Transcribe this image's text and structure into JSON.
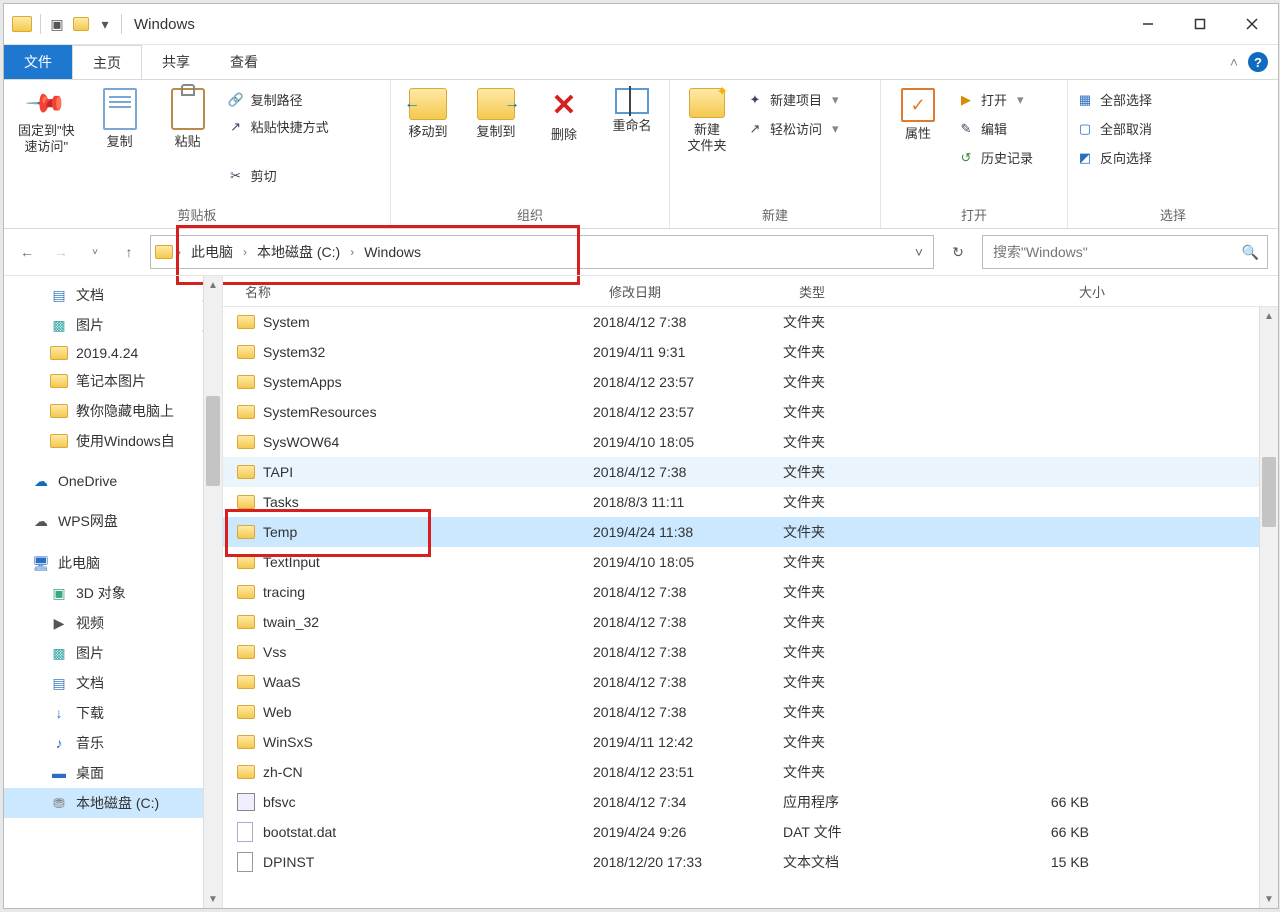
{
  "window": {
    "title": "Windows"
  },
  "tabs": {
    "file": "文件",
    "home": "主页",
    "share": "共享",
    "view": "查看"
  },
  "ribbon": {
    "clipboard": {
      "pin": "固定到\"快\n速访问\"",
      "copy": "复制",
      "paste": "粘贴",
      "copy_path": "复制路径",
      "paste_shortcut": "粘贴快捷方式",
      "cut": "剪切",
      "group": "剪贴板"
    },
    "organize": {
      "move_to": "移动到",
      "copy_to": "复制到",
      "delete": "删除",
      "rename": "重命名",
      "group": "组织"
    },
    "new": {
      "new_folder": "新建\n文件夹",
      "new_item": "新建项目",
      "easy_access": "轻松访问",
      "group": "新建"
    },
    "open": {
      "properties": "属性",
      "open": "打开",
      "edit": "编辑",
      "history": "历史记录",
      "group": "打开"
    },
    "select": {
      "select_all": "全部选择",
      "select_none": "全部取消",
      "invert": "反向选择",
      "group": "选择"
    }
  },
  "breadcrumb": {
    "pc": "此电脑",
    "drive": "本地磁盘 (C:)",
    "folder": "Windows"
  },
  "search": {
    "placeholder": "搜索\"Windows\""
  },
  "sidebar": {
    "documents": "文档",
    "pictures": "图片",
    "date_folder": "2019.4.24",
    "notebook_pics": "笔记本图片",
    "teach_hide_pc": "教你隐藏电脑上",
    "use_windows": "使用Windows自",
    "onedrive": "OneDrive",
    "wps": "WPS网盘",
    "this_pc": "此电脑",
    "objects3d": "3D 对象",
    "videos": "视频",
    "pictures2": "图片",
    "documents2": "文档",
    "downloads": "下载",
    "music": "音乐",
    "desktop": "桌面",
    "local_disk_c": "本地磁盘 (C:)"
  },
  "columns": {
    "name": "名称",
    "date": "修改日期",
    "type": "类型",
    "size": "大小"
  },
  "files": [
    {
      "icon": "folder",
      "name": "System",
      "date": "2018/4/12 7:38",
      "type": "文件夹",
      "size": ""
    },
    {
      "icon": "folder",
      "name": "System32",
      "date": "2019/4/11 9:31",
      "type": "文件夹",
      "size": ""
    },
    {
      "icon": "folder",
      "name": "SystemApps",
      "date": "2018/4/12 23:57",
      "type": "文件夹",
      "size": ""
    },
    {
      "icon": "folder",
      "name": "SystemResources",
      "date": "2018/4/12 23:57",
      "type": "文件夹",
      "size": ""
    },
    {
      "icon": "folder",
      "name": "SysWOW64",
      "date": "2019/4/10 18:05",
      "type": "文件夹",
      "size": ""
    },
    {
      "icon": "folder",
      "name": "TAPI",
      "date": "2018/4/12 7:38",
      "type": "文件夹",
      "size": "",
      "hi": true
    },
    {
      "icon": "folder",
      "name": "Tasks",
      "date": "2018/8/3 11:11",
      "type": "文件夹",
      "size": ""
    },
    {
      "icon": "folder",
      "name": "Temp",
      "date": "2019/4/24 11:38",
      "type": "文件夹",
      "size": "",
      "sel": true,
      "redbox": true
    },
    {
      "icon": "folder",
      "name": "TextInput",
      "date": "2019/4/10 18:05",
      "type": "文件夹",
      "size": ""
    },
    {
      "icon": "folder",
      "name": "tracing",
      "date": "2018/4/12 7:38",
      "type": "文件夹",
      "size": ""
    },
    {
      "icon": "folder",
      "name": "twain_32",
      "date": "2018/4/12 7:38",
      "type": "文件夹",
      "size": ""
    },
    {
      "icon": "folder",
      "name": "Vss",
      "date": "2018/4/12 7:38",
      "type": "文件夹",
      "size": ""
    },
    {
      "icon": "folder",
      "name": "WaaS",
      "date": "2018/4/12 7:38",
      "type": "文件夹",
      "size": ""
    },
    {
      "icon": "folder",
      "name": "Web",
      "date": "2018/4/12 7:38",
      "type": "文件夹",
      "size": ""
    },
    {
      "icon": "folder",
      "name": "WinSxS",
      "date": "2019/4/11 12:42",
      "type": "文件夹",
      "size": ""
    },
    {
      "icon": "folder",
      "name": "zh-CN",
      "date": "2018/4/12 23:51",
      "type": "文件夹",
      "size": ""
    },
    {
      "icon": "exe",
      "name": "bfsvc",
      "date": "2018/4/12 7:34",
      "type": "应用程序",
      "size": "66 KB"
    },
    {
      "icon": "file",
      "name": "bootstat.dat",
      "date": "2019/4/24 9:26",
      "type": "DAT 文件",
      "size": "66 KB"
    },
    {
      "icon": "txt",
      "name": "DPINST",
      "date": "2018/12/20 17:33",
      "type": "文本文档",
      "size": "15 KB"
    }
  ]
}
